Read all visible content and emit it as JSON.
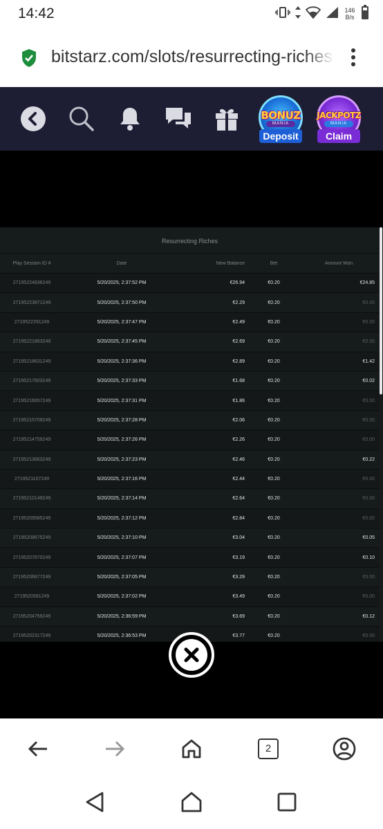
{
  "status_bar": {
    "time": "14:42",
    "net_speed_value": "146",
    "net_speed_unit": "B/s"
  },
  "browser": {
    "url": "bitstarz.com/slots/resurrecting-riches",
    "tab_count": "2"
  },
  "header": {
    "promos": [
      {
        "title": "BONUZ",
        "subtitle": "MANIA",
        "button": "Deposit"
      },
      {
        "title": "JACKPOTZ",
        "subtitle": "MANIA",
        "button": "Claim"
      }
    ]
  },
  "history": {
    "title": "Resurrecting Riches",
    "columns": [
      "Play Session ID #",
      "Date",
      "New Balance",
      "Bet",
      "Amount Won"
    ],
    "rows": [
      {
        "id": "27195224836249",
        "date": "5/20/2025, 2:37:52 PM",
        "balance": "€26.94",
        "bet": "€0.20",
        "won": "€24.85"
      },
      {
        "id": "27195223871249",
        "date": "5/20/2025, 2:37:50 PM",
        "balance": "€2.29",
        "bet": "€0.20",
        "won": "€0.00"
      },
      {
        "id": "2719522291249",
        "date": "5/20/2025, 2:37:47 PM",
        "balance": "€2.49",
        "bet": "€0.20",
        "won": "€0.00"
      },
      {
        "id": "27195221863249",
        "date": "5/20/2025, 2:37:45 PM",
        "balance": "€2.69",
        "bet": "€0.20",
        "won": "€0.00"
      },
      {
        "id": "27195218631249",
        "date": "5/20/2025, 2:37:36 PM",
        "balance": "€2.89",
        "bet": "€0.20",
        "won": "€1.42"
      },
      {
        "id": "27195217603249",
        "date": "5/20/2025, 2:37:33 PM",
        "balance": "€1.68",
        "bet": "€0.20",
        "won": "€0.02"
      },
      {
        "id": "27195216657249",
        "date": "5/20/2025, 2:37:31 PM",
        "balance": "€1.86",
        "bet": "€0.20",
        "won": "€0.00"
      },
      {
        "id": "27195215709249",
        "date": "5/20/2025, 2:37:28 PM",
        "balance": "€2.06",
        "bet": "€0.20",
        "won": "€0.00"
      },
      {
        "id": "27195214759249",
        "date": "5/20/2025, 2:37:26 PM",
        "balance": "€2.26",
        "bet": "€0.20",
        "won": "€0.00"
      },
      {
        "id": "27195213663249",
        "date": "5/20/2025, 2:37:23 PM",
        "balance": "€2.46",
        "bet": "€0.20",
        "won": "€0.22"
      },
      {
        "id": "2719521107249",
        "date": "5/20/2025, 2:37:16 PM",
        "balance": "€2.44",
        "bet": "€0.20",
        "won": "€0.00"
      },
      {
        "id": "27195210149249",
        "date": "5/20/2025, 2:37:14 PM",
        "balance": "€2.64",
        "bet": "€0.20",
        "won": "€0.00"
      },
      {
        "id": "27195209585249",
        "date": "5/20/2025, 2:37:12 PM",
        "balance": "€2.84",
        "bet": "€0.20",
        "won": "€0.00"
      },
      {
        "id": "27195208675249",
        "date": "5/20/2025, 2:37:10 PM",
        "balance": "€3.04",
        "bet": "€0.20",
        "won": "€0.05"
      },
      {
        "id": "27195207670249",
        "date": "5/20/2025, 2:37:07 PM",
        "balance": "€3.19",
        "bet": "€0.20",
        "won": "€0.10"
      },
      {
        "id": "27195206677249",
        "date": "5/20/2025, 2:37:05 PM",
        "balance": "€3.29",
        "bet": "€0.20",
        "won": "€0.00"
      },
      {
        "id": "2719520581249",
        "date": "5/20/2025, 2:37:02 PM",
        "balance": "€3.49",
        "bet": "€0.20",
        "won": "€0.00"
      },
      {
        "id": "27195204759249",
        "date": "5/20/2025, 2:36:59 PM",
        "balance": "€3.69",
        "bet": "€0.20",
        "won": "€0.12"
      },
      {
        "id": "27195202317249",
        "date": "5/20/2025, 2:36:53 PM",
        "balance": "€3.77",
        "bet": "€0.20",
        "won": "€0.00"
      }
    ]
  },
  "colors": {
    "header_bg": "#1d1d33",
    "panel_bg": "#161b1c",
    "shield_green": "#1e8e3e"
  }
}
